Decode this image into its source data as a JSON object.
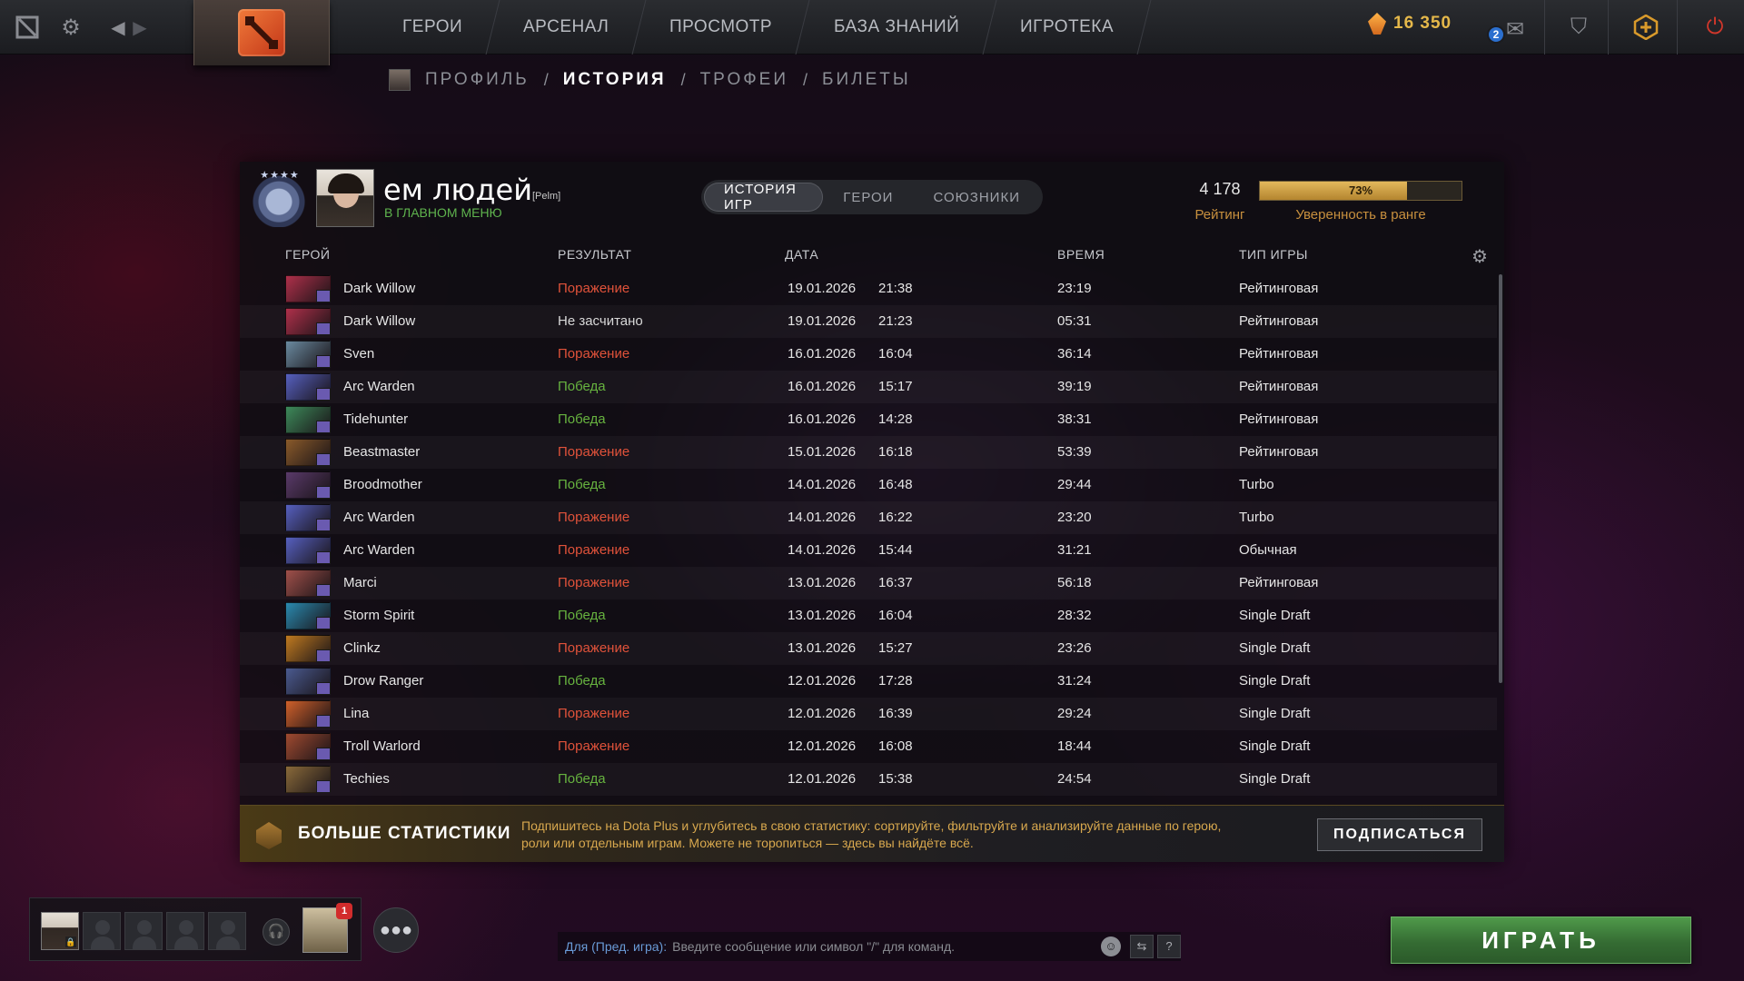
{
  "topbar": {
    "nav": [
      "Герои",
      "Арсенал",
      "Просмотр",
      "База знаний",
      "Игротека"
    ],
    "currency_value": "16 350",
    "messages_badge": "2",
    "icons": [
      "dashboard-icon",
      "gear-icon",
      "back-icon",
      "forward-icon",
      "dota-logo",
      "shards-icon",
      "mail-icon",
      "armory-icon",
      "plus-icon",
      "power-icon"
    ]
  },
  "subnav": {
    "items": [
      "Профиль",
      "История",
      "Трофеи",
      "Билеты"
    ],
    "active": "История",
    "separator": "/"
  },
  "profile": {
    "name": "ем людей",
    "tag": "[Pelm]",
    "status": "В главном меню"
  },
  "tabs": {
    "items": [
      "История игр",
      "Герои",
      "Союзники"
    ],
    "active": "История игр"
  },
  "rating": {
    "value": "4 178",
    "label": "Рейтинг",
    "confidence_pct": 73,
    "confidence_text": "73%",
    "confidence_label": "Уверенность в ранге"
  },
  "table": {
    "columns": [
      "Герой",
      "Результат",
      "Дата",
      "Время",
      "Тип игры"
    ],
    "rows": [
      {
        "hero": "Dark Willow",
        "result": "Поражение",
        "outcome": "loss",
        "date": "19.01.2026",
        "time": "21:38",
        "duration": "23:19",
        "type": "Рейтинговая",
        "color": "#b0304a"
      },
      {
        "hero": "Dark Willow",
        "result": "Не засчитано",
        "outcome": "none",
        "date": "19.01.2026",
        "time": "21:23",
        "duration": "05:31",
        "type": "Рейтинговая",
        "color": "#b0304a"
      },
      {
        "hero": "Sven",
        "result": "Поражение",
        "outcome": "loss",
        "date": "16.01.2026",
        "time": "16:04",
        "duration": "36:14",
        "type": "Рейтинговая",
        "color": "#6a8aa0"
      },
      {
        "hero": "Arc Warden",
        "result": "Победа",
        "outcome": "win",
        "date": "16.01.2026",
        "time": "15:17",
        "duration": "39:19",
        "type": "Рейтинговая",
        "color": "#5660c0"
      },
      {
        "hero": "Tidehunter",
        "result": "Победа",
        "outcome": "win",
        "date": "16.01.2026",
        "time": "14:28",
        "duration": "38:31",
        "type": "Рейтинговая",
        "color": "#3d8a5a"
      },
      {
        "hero": "Beastmaster",
        "result": "Поражение",
        "outcome": "loss",
        "date": "15.01.2026",
        "time": "16:18",
        "duration": "53:39",
        "type": "Рейтинговая",
        "color": "#8a5a2a"
      },
      {
        "hero": "Broodmother",
        "result": "Победа",
        "outcome": "win",
        "date": "14.01.2026",
        "time": "16:48",
        "duration": "29:44",
        "type": "Turbo",
        "color": "#5a3a6a"
      },
      {
        "hero": "Arc Warden",
        "result": "Поражение",
        "outcome": "loss",
        "date": "14.01.2026",
        "time": "16:22",
        "duration": "23:20",
        "type": "Turbo",
        "color": "#5660c0"
      },
      {
        "hero": "Arc Warden",
        "result": "Поражение",
        "outcome": "loss",
        "date": "14.01.2026",
        "time": "15:44",
        "duration": "31:21",
        "type": "Обычная",
        "color": "#5660c0"
      },
      {
        "hero": "Marci",
        "result": "Поражение",
        "outcome": "loss",
        "date": "13.01.2026",
        "time": "16:37",
        "duration": "56:18",
        "type": "Рейтинговая",
        "color": "#a0504a"
      },
      {
        "hero": "Storm Spirit",
        "result": "Победа",
        "outcome": "win",
        "date": "13.01.2026",
        "time": "16:04",
        "duration": "28:32",
        "type": "Single Draft",
        "color": "#2a8ab0"
      },
      {
        "hero": "Clinkz",
        "result": "Поражение",
        "outcome": "loss",
        "date": "13.01.2026",
        "time": "15:27",
        "duration": "23:26",
        "type": "Single Draft",
        "color": "#c07a20"
      },
      {
        "hero": "Drow Ranger",
        "result": "Победа",
        "outcome": "win",
        "date": "12.01.2026",
        "time": "17:28",
        "duration": "31:24",
        "type": "Single Draft",
        "color": "#4a5a90"
      },
      {
        "hero": "Lina",
        "result": "Поражение",
        "outcome": "loss",
        "date": "12.01.2026",
        "time": "16:39",
        "duration": "29:24",
        "type": "Single Draft",
        "color": "#d0602a"
      },
      {
        "hero": "Troll Warlord",
        "result": "Поражение",
        "outcome": "loss",
        "date": "12.01.2026",
        "time": "16:08",
        "duration": "18:44",
        "type": "Single Draft",
        "color": "#a04a30"
      },
      {
        "hero": "Techies",
        "result": "Победа",
        "outcome": "win",
        "date": "12.01.2026",
        "time": "15:38",
        "duration": "24:54",
        "type": "Single Draft",
        "color": "#8a6a3a"
      }
    ]
  },
  "promo": {
    "title": "Больше статистики",
    "text": "Подпишитесь на Dota Plus и углубитесь в свою статистику: сортируйте, фильтруйте и анализируйте данные по герою, роли или отдельным играм. Можете не торопиться — здесь вы найдёте всё.",
    "button": "Подписаться"
  },
  "party": {
    "companion_badge": "1"
  },
  "chat": {
    "channel": "Для (Пред. игра):",
    "placeholder": "Введите сообщение или символ \"/\" для команд.",
    "help": "?"
  },
  "play_button": "Играть"
}
